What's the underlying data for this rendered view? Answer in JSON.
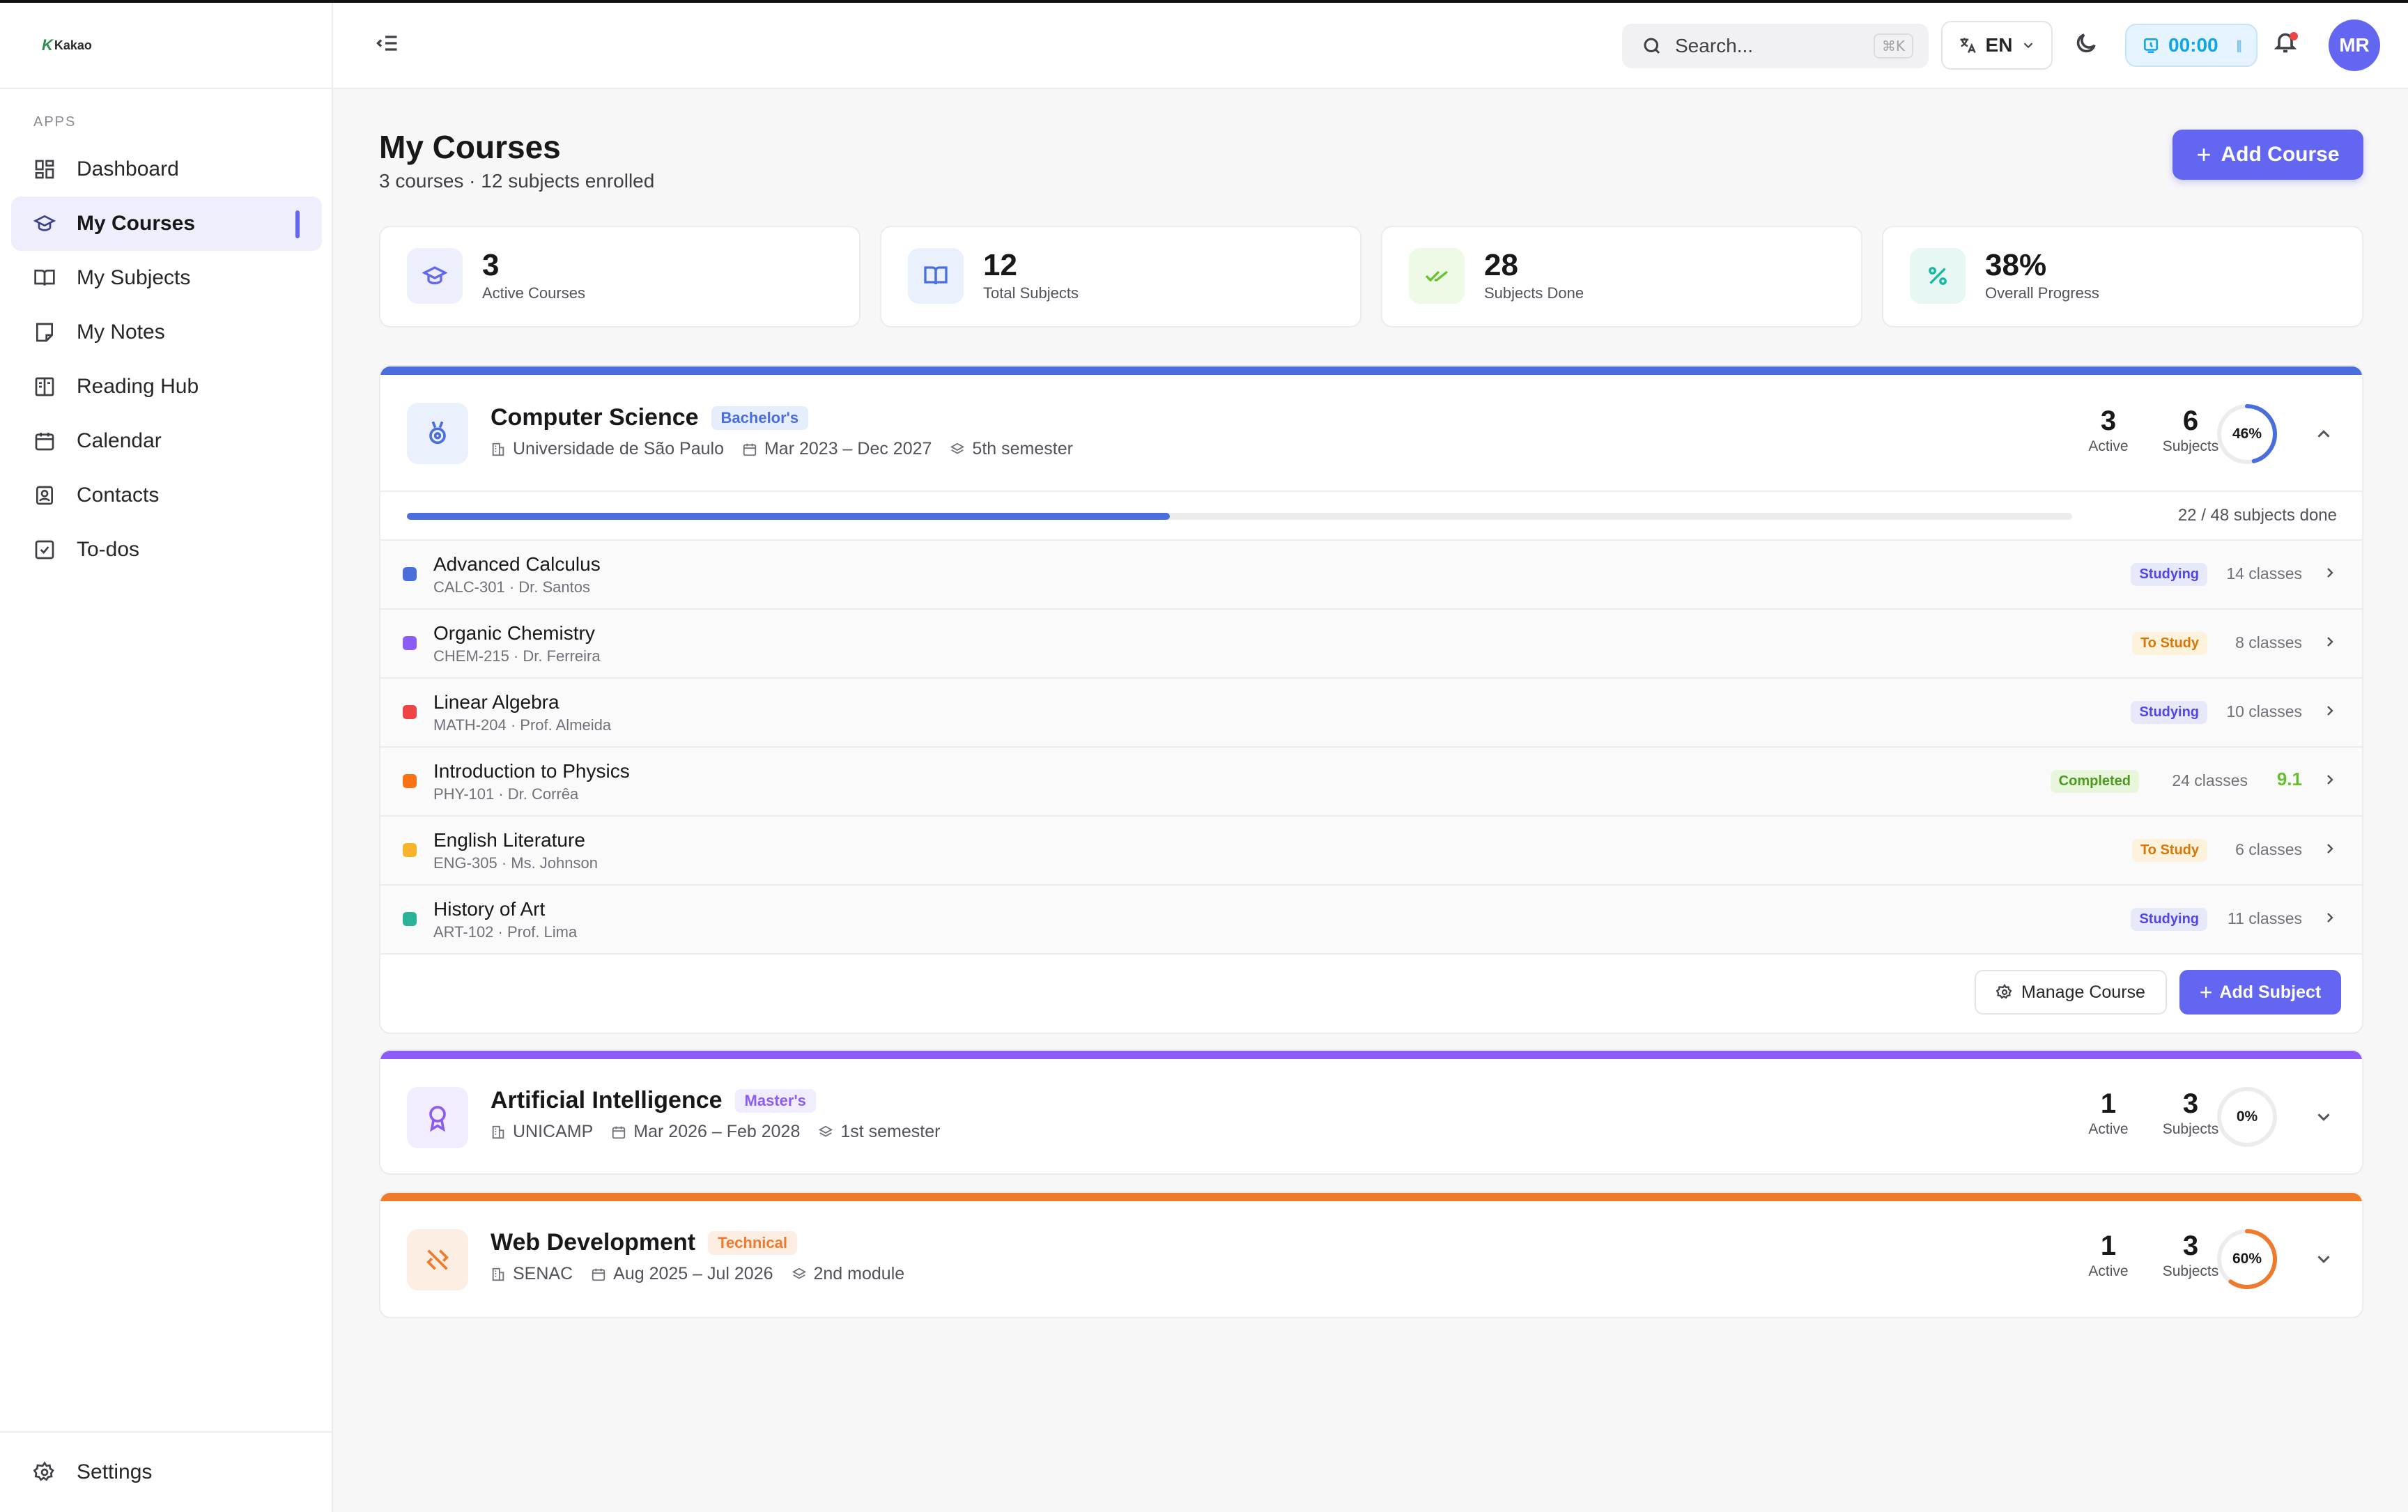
{
  "brand": {
    "logo_text": "Kakao"
  },
  "sidebar": {
    "section_label": "APPS",
    "items": [
      {
        "label": "Dashboard",
        "icon": "dashboard-icon"
      },
      {
        "label": "My Courses",
        "icon": "graduation-cap-icon",
        "active": true
      },
      {
        "label": "My Subjects",
        "icon": "book-open-icon"
      },
      {
        "label": "My Notes",
        "icon": "sticky-note-icon"
      },
      {
        "label": "Reading Hub",
        "icon": "reader-icon"
      },
      {
        "label": "Calendar",
        "icon": "calendar-icon"
      },
      {
        "label": "Contacts",
        "icon": "contact-book-icon"
      },
      {
        "label": "To-dos",
        "icon": "checkbox-icon"
      }
    ],
    "settings_label": "Settings"
  },
  "header": {
    "search_placeholder": "Search...",
    "search_shortcut": "⌘K",
    "language": "EN",
    "timer": "00:00",
    "avatar_initials": "MR"
  },
  "page": {
    "title": "My Courses",
    "subtitle": "3 courses · 12 subjects enrolled",
    "add_course_label": "Add Course"
  },
  "stats": [
    {
      "value": "3",
      "label": "Active Courses",
      "icon": "graduation-cap-icon",
      "color": "#6366f1",
      "bg": "#eeeffd"
    },
    {
      "value": "12",
      "label": "Total Subjects",
      "icon": "book-open-icon",
      "color": "#4a6fdc",
      "bg": "#ebf0fd"
    },
    {
      "value": "28",
      "label": "Subjects Done",
      "icon": "check-check-icon",
      "color": "#65c22e",
      "bg": "#eef9e6"
    },
    {
      "value": "38%",
      "label": "Overall Progress",
      "icon": "percent-icon",
      "color": "#14b8a6",
      "bg": "#e6f7f4"
    }
  ],
  "courses": [
    {
      "name": "Computer Science",
      "degree": "Bachelor's",
      "institution": "Universidade de São Paulo",
      "period": "Mar 2023 – Dec 2027",
      "term": "5th semester",
      "active": "3",
      "active_label": "Active",
      "subjects": "6",
      "subjects_label": "Subjects",
      "progress": 46,
      "progress_label": "46%",
      "color": "#4a6fdc",
      "expanded": true,
      "subjects_done_text": "22 / 48 subjects done",
      "subjects_done_fraction": 0.458,
      "subject_list": [
        {
          "name": "Advanced Calculus",
          "code": "CALC-301 · Dr. Santos",
          "status": "Studying",
          "classes": "14 classes",
          "color": "#4a6fdc"
        },
        {
          "name": "Organic Chemistry",
          "code": "CHEM-215 · Dr. Ferreira",
          "status": "To Study",
          "classes": "8 classes",
          "color": "#8b5cf6"
        },
        {
          "name": "Linear Algebra",
          "code": "MATH-204 · Prof. Almeida",
          "status": "Studying",
          "classes": "10 classes",
          "color": "#ef4444"
        },
        {
          "name": "Introduction to Physics",
          "code": "PHY-101 · Dr. Corrêa",
          "status": "Completed",
          "classes": "24 classes",
          "grade": "9.1",
          "color": "#f97316"
        },
        {
          "name": "English Literature",
          "code": "ENG-305 · Ms. Johnson",
          "status": "To Study",
          "classes": "6 classes",
          "color": "#f5b42a"
        },
        {
          "name": "History of Art",
          "code": "ART-102 · Prof. Lima",
          "status": "Studying",
          "classes": "11 classes",
          "color": "#2bb39a"
        }
      ],
      "manage_label": "Manage Course",
      "add_subject_label": "Add Subject"
    },
    {
      "name": "Artificial Intelligence",
      "degree": "Master's",
      "institution": "UNICAMP",
      "period": "Mar 2026 – Feb 2028",
      "term": "1st semester",
      "active": "1",
      "active_label": "Active",
      "subjects": "3",
      "subjects_label": "Subjects",
      "progress": 0,
      "progress_label": "0%",
      "color": "#8b5cf6",
      "expanded": false
    },
    {
      "name": "Web Development",
      "degree": "Technical",
      "institution": "SENAC",
      "period": "Aug 2025 – Jul 2026",
      "term": "2nd module",
      "active": "1",
      "active_label": "Active",
      "subjects": "3",
      "subjects_label": "Subjects",
      "progress": 60,
      "progress_label": "60%",
      "color": "#f07a2c",
      "expanded": false
    }
  ],
  "status_styles": {
    "Studying": {
      "fg": "#4f46e5",
      "bg": "#e8e8fb"
    },
    "To Study": {
      "fg": "#d97706",
      "bg": "#fdf3dc"
    },
    "Completed": {
      "fg": "#4d9a1e",
      "bg": "#e8f6dc"
    }
  }
}
